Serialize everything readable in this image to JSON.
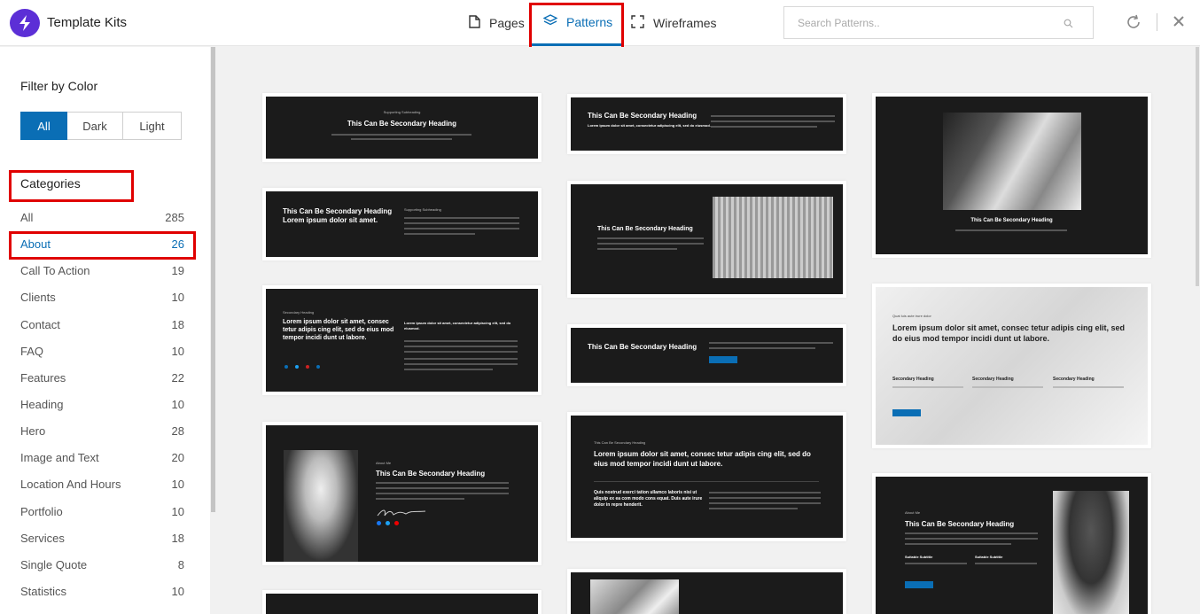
{
  "app": {
    "title": "Template Kits"
  },
  "tabs": [
    {
      "label": "Pages",
      "icon": "page-icon",
      "active": false
    },
    {
      "label": "Patterns",
      "icon": "layers-icon",
      "active": true
    },
    {
      "label": "Wireframes",
      "icon": "wireframe-icon",
      "active": false
    }
  ],
  "search": {
    "placeholder": "Search Patterns.."
  },
  "sidebar": {
    "filter_title": "Filter by Color",
    "color_filters": [
      "All",
      "Dark",
      "Light"
    ],
    "selected_color": "All",
    "categories_title": "Categories",
    "categories": [
      {
        "name": "All",
        "count": "285"
      },
      {
        "name": "About",
        "count": "26"
      },
      {
        "name": "Call To Action",
        "count": "19"
      },
      {
        "name": "Clients",
        "count": "10"
      },
      {
        "name": "Contact",
        "count": "18"
      },
      {
        "name": "FAQ",
        "count": "10"
      },
      {
        "name": "Features",
        "count": "22"
      },
      {
        "name": "Heading",
        "count": "10"
      },
      {
        "name": "Hero",
        "count": "28"
      },
      {
        "name": "Image and Text",
        "count": "20"
      },
      {
        "name": "Location And Hours",
        "count": "10"
      },
      {
        "name": "Portfolio",
        "count": "10"
      },
      {
        "name": "Services",
        "count": "18"
      },
      {
        "name": "Single Quote",
        "count": "8"
      },
      {
        "name": "Statistics",
        "count": "10"
      }
    ],
    "selected_category": "About"
  },
  "patterns": {
    "supporting_subheading": "Supporting Subheading",
    "secondary_heading": "This Can Be Secondary Heading",
    "lorem_short": "Lorem ipsum dolor sit amet.",
    "lorem_consec": "Lorem ipsum dolor sit amet, consectetur adipiscing elit, sed do eiusmod.",
    "secondary_heading_label": "Secondary Heading",
    "lorem_long": "Lorem ipsum dolor sit amet, consec tetur adipis cing elit, sed do eius mod tempor incidi dunt ut labore.",
    "lorem_long2": "Lorem ipsum dolor sit amet, consec tetur adipis cing elit, sed do eius mod tempor incidi dunt ut labore.",
    "this_can_be_secondary_subheading": "This Can Be Secondary Heading",
    "quis_text": "Quis nostrud exerci tation ullamco laboris nisi ut aliquip ex ea com modo cons equat. Duis aute irure dolor in repre henderit.",
    "about_me": "About Me",
    "quat_label": "Quat luis aute irure dolor",
    "secondary_heading_short": "Secondary Heading",
    "suitable_subtitle": "Suitable Subtitle",
    "call_to_action": "Call To Action"
  },
  "colors": {
    "accent": "#0a6eb5",
    "highlight": "#e00000",
    "logo": "#5c2fd6"
  }
}
